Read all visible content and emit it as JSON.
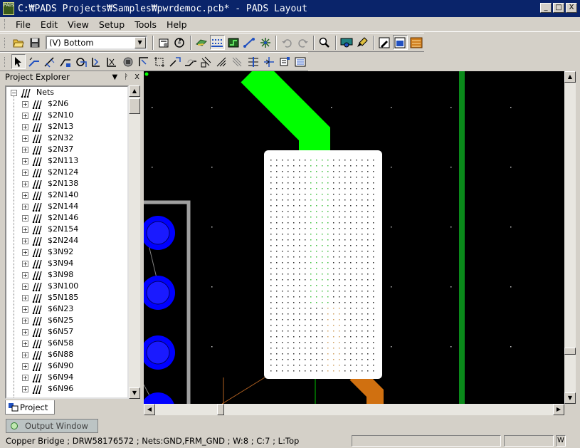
{
  "window": {
    "title": "C:₩PADS Projects₩Samples₩pwrdemoc.pcb* - PADS Layout",
    "app_icon_text": "PADS",
    "controls": [
      "_",
      "□",
      "X"
    ]
  },
  "menu": [
    "File",
    "Edit",
    "View",
    "Setup",
    "Tools",
    "Help"
  ],
  "toolbar1": {
    "layer_value": "(V) Bottom",
    "icons": [
      "open-folder-icon",
      "save-icon",
      "layer-select",
      "board-setup-icon",
      "redraw-icon",
      "design-toolbar-icon",
      "drafting-toolbar-icon",
      "route-icon",
      "ecno-icon",
      "undo-icon",
      "redo-icon",
      "zoom-icon",
      "view-icon",
      "paint-icon",
      "sketch-icon",
      "display-icon",
      "reports-icon"
    ]
  },
  "toolbar2": {
    "icons": [
      "select-mode-icon",
      "add-route-icon",
      "dynamic-route-icon",
      "sketch-route-icon",
      "auto-route-icon",
      "bus-route-icon",
      "cross-probe-icon",
      "stop-icon",
      "select-corner-icon",
      "select-box-icon",
      "split-icon",
      "add-miter-icon",
      "stretch-icon",
      "move-icon",
      "spread-icon",
      "align-icon",
      "center-icon",
      "tune-icon",
      "properties-icon"
    ]
  },
  "explorer": {
    "title": "Project Explorer",
    "header_buttons": [
      "▼",
      "ᚹ",
      "X"
    ],
    "root_label": "Nets",
    "nets": [
      "$2N6",
      "$2N10",
      "$2N13",
      "$2N32",
      "$2N37",
      "$2N113",
      "$2N124",
      "$2N138",
      "$2N140",
      "$2N144",
      "$2N146",
      "$2N154",
      "$2N244",
      "$3N92",
      "$3N94",
      "$3N98",
      "$3N100",
      "$5N185",
      "$6N23",
      "$6N25",
      "$6N57",
      "$6N58",
      "$6N88",
      "$6N90",
      "$6N94",
      "$6N96"
    ],
    "tab_label": "Project"
  },
  "output_window": {
    "label": "Output Window"
  },
  "status": {
    "text": "Copper Bridge ; DRW58176572 ; Nets:GND,FRM_GND ; W:8 ; C:7 ; L:Top",
    "indicator": "W"
  },
  "colors": {
    "canvas_bg": "#000000",
    "trace_green": "#00ff00",
    "trace_dark_green": "#0a8a1a",
    "copper_white": "#ffffff",
    "pad_blue": "#0000ff",
    "trace_orange": "#d07010",
    "outline_gray": "#a0a0a0"
  }
}
